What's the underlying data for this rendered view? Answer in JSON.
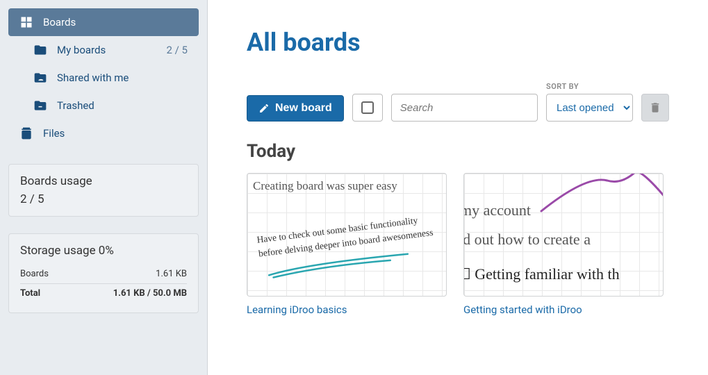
{
  "sidebar": {
    "items": [
      {
        "label": "Boards",
        "count": ""
      },
      {
        "label": "My boards",
        "count": "2 / 5"
      },
      {
        "label": "Shared with me",
        "count": ""
      },
      {
        "label": "Trashed",
        "count": ""
      },
      {
        "label": "Files",
        "count": ""
      }
    ]
  },
  "boards_usage": {
    "title": "Boards usage",
    "value": "2 / 5"
  },
  "storage_usage": {
    "title": "Storage usage 0%",
    "rows": [
      {
        "label": "Boards",
        "value": "1.61 KB"
      },
      {
        "label": "Total",
        "value": "1.61 KB / 50.0 MB"
      }
    ]
  },
  "page": {
    "title": "All boards",
    "new_board_label": "New board",
    "search_placeholder": "Search",
    "sort_label": "SORT BY",
    "sort_selected": "Last opened",
    "section_heading": "Today"
  },
  "boards": [
    {
      "title": "Learning iDroo basics",
      "thumb": {
        "line1": "Creating board was super easy",
        "line2": "Have to check out some basic functionality before delving deeper into board awesomeness"
      }
    },
    {
      "title": "Getting started with iDroo",
      "thumb": {
        "line1": "my account",
        "line2": "ured out how to create a",
        "line3": "☐ Getting familiar with th"
      }
    }
  ],
  "colors": {
    "primary": "#1a6aa8",
    "accent_teal": "#2aa6b0",
    "accent_purple": "#9a4aa8"
  }
}
